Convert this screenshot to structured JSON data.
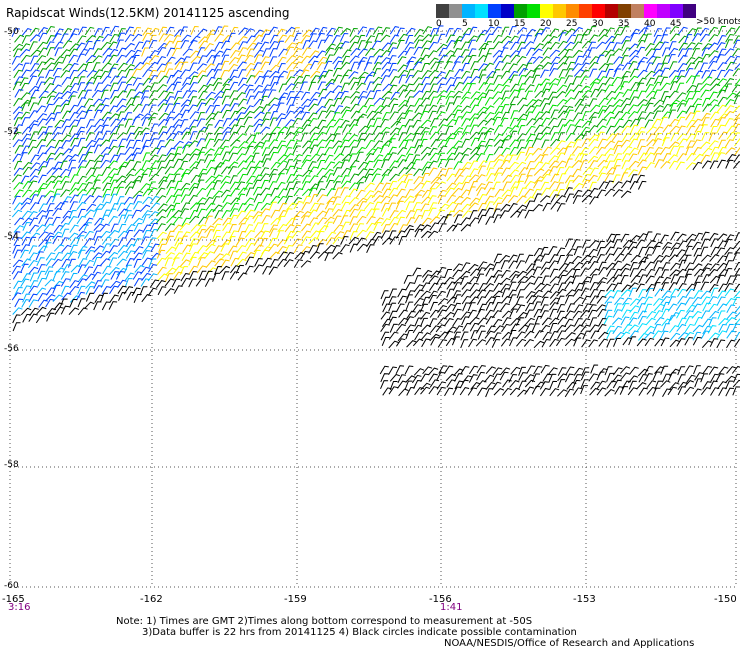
{
  "title": "Rapidscat Winds(12.5KM) 20141125 ascending",
  "legend": {
    "units": ">50 knots",
    "labels": [
      "0",
      "5",
      "10",
      "15",
      "20",
      "25",
      "30",
      "35",
      "40",
      "45"
    ],
    "colors": [
      "#404040",
      "#909090",
      "#00b4ff",
      "#00e0ff",
      "#0040ff",
      "#0000c8",
      "#00a000",
      "#00e000",
      "#ffff00",
      "#ffc800",
      "#ff8c00",
      "#ff4000",
      "#ff0000",
      "#b40000",
      "#804000",
      "#c08060",
      "#ff00ff",
      "#c000ff",
      "#8000ff",
      "#400080"
    ]
  },
  "axes": {
    "lat_labels": [
      "-50",
      "-52",
      "-54",
      "-56",
      "-58",
      "-60"
    ],
    "lon_labels": [
      "-165",
      "-162",
      "-159",
      "-156",
      "-153",
      "-150"
    ]
  },
  "time_labels": [
    "3:16",
    "1:41"
  ],
  "notes": {
    "line1": "Note: 1) Times are GMT 2)Times along bottom correspond to measurement at -50S",
    "line2": "3)Data buffer is 22 hrs from 20141125 4) Black circles indicate possible contamination",
    "credit": "NOAA/NESDIS/Office of Research and Applications"
  }
}
